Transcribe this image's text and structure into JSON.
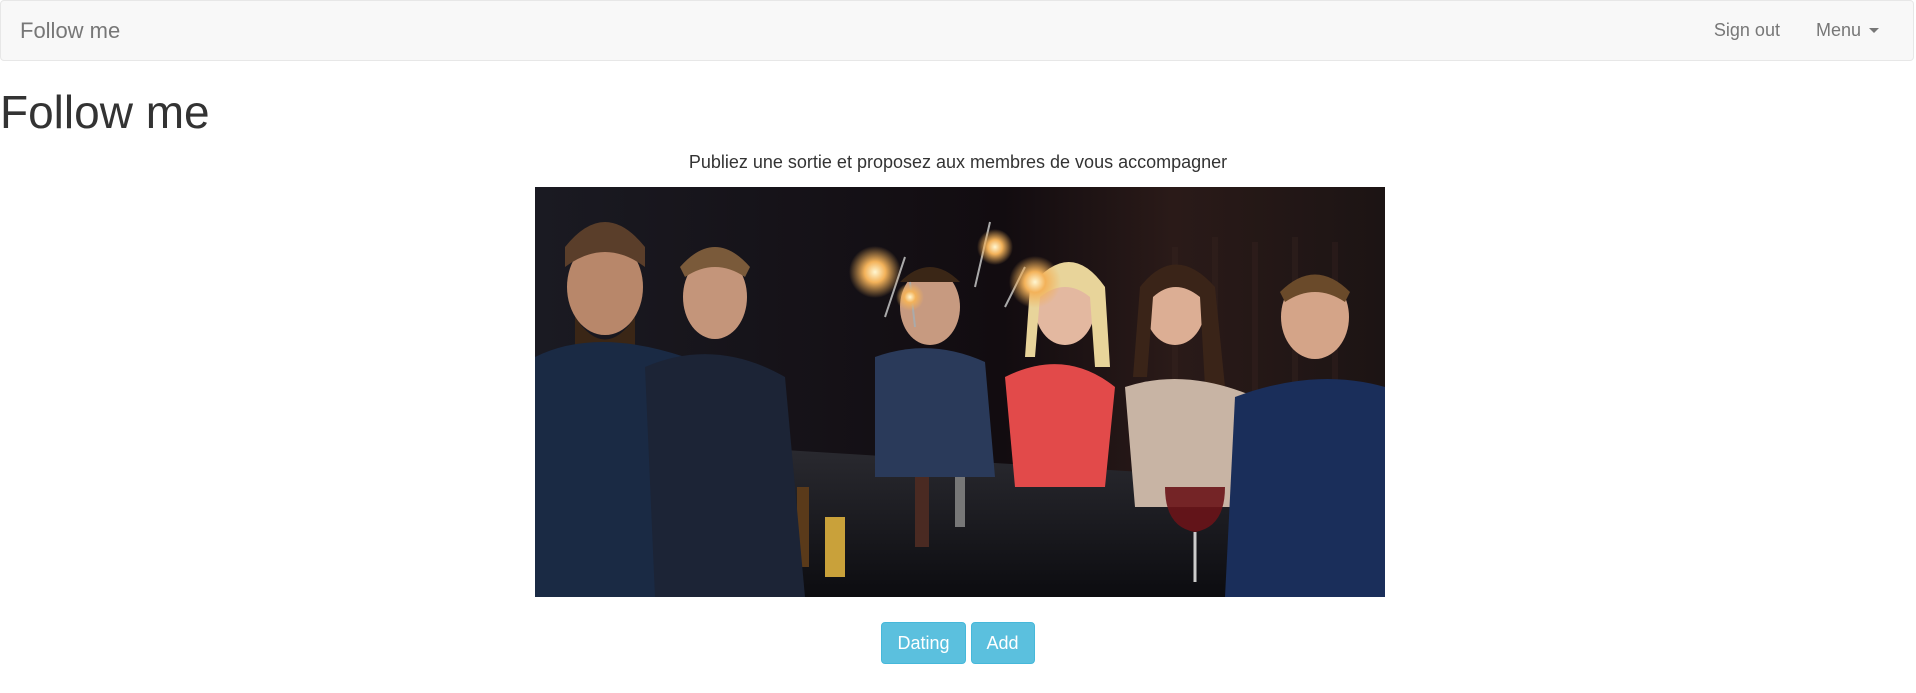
{
  "navbar": {
    "brand": "Follow me",
    "sign_out_label": "Sign out",
    "menu_label": "Menu"
  },
  "main": {
    "title": "Follow me",
    "subtitle": "Publiez une sortie et proposez aux membres de vous accompagner",
    "photo_alt": "Group of friends at a bar holding sparklers",
    "buttons": {
      "dating_label": "Dating",
      "add_label": "Add"
    }
  },
  "colors": {
    "navbar_bg": "#f8f8f8",
    "button_info": "#5bc0de",
    "text_main": "#333333",
    "text_nav": "#777777"
  }
}
